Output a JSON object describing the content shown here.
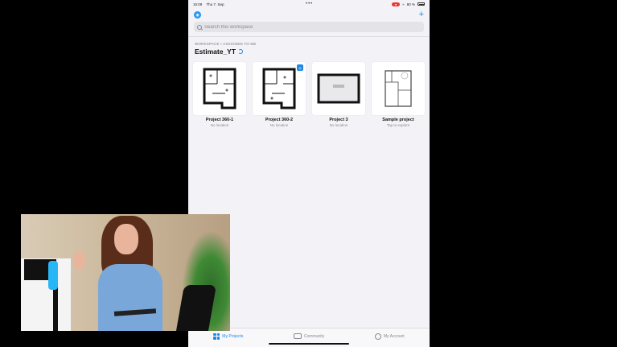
{
  "status_bar": {
    "time": "15:09",
    "date": "Thu 7. Sep",
    "battery": "80 %"
  },
  "search": {
    "placeholder": "Search this workspace"
  },
  "workspace": {
    "label": "WORKSPACE • ASSIGNED TO ME",
    "title": "Estimate_YT"
  },
  "projects": [
    {
      "title": "Project 360-1",
      "subtitle": "No location",
      "badge": false
    },
    {
      "title": "Project 360-2",
      "subtitle": "No location",
      "badge": true
    },
    {
      "title": "Project 3",
      "subtitle": "No location",
      "badge": false
    },
    {
      "title": "Sample project",
      "subtitle": "Tap to explore",
      "badge": false
    }
  ],
  "tabs": {
    "projects": "My Projects",
    "community": "Community",
    "account": "My Account"
  },
  "colors": {
    "accent": "#1e88e5",
    "background": "#f2f2f7"
  }
}
